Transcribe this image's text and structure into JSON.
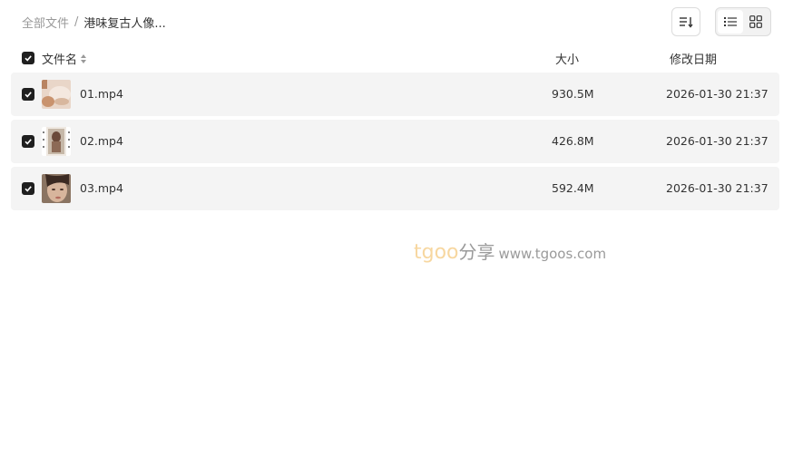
{
  "breadcrumb": {
    "root": "全部文件",
    "separator": "/",
    "current": "港味复古人像..."
  },
  "toolbar": {
    "sort_icon": "sort-icon",
    "list_view_icon": "list-view-icon",
    "grid_view_icon": "grid-view-icon",
    "active_view": "list"
  },
  "table": {
    "headers": {
      "name": "文件名",
      "size": "大小",
      "modified": "修改日期"
    },
    "rows": [
      {
        "name": "01.mp4",
        "size": "930.5M",
        "modified": "2026-01-30 21:37",
        "checked": true
      },
      {
        "name": "02.mp4",
        "size": "426.8M",
        "modified": "2026-01-30 21:37",
        "checked": true
      },
      {
        "name": "03.mp4",
        "size": "592.4M",
        "modified": "2026-01-30 21:37",
        "checked": true
      }
    ]
  },
  "watermark": {
    "brand": "tgoo",
    "cn": "分享",
    "url": "www.tgoos.com"
  },
  "colors": {
    "checkbox": "#1f1f1f",
    "row_bg": "#f4f4f4",
    "muted_text": "#999999",
    "watermark_brand": "#f7d7a0"
  }
}
